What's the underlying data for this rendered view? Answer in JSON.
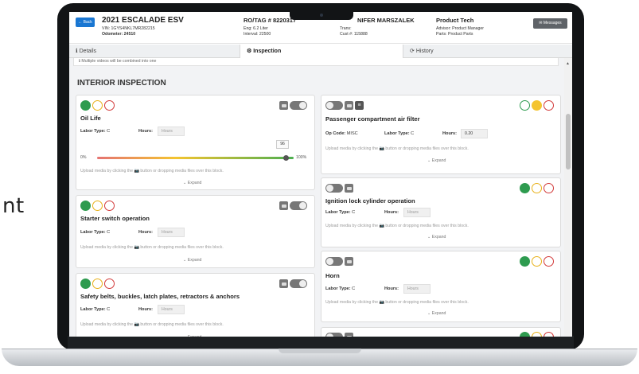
{
  "side_text": "nt",
  "header": {
    "back_label": "← Back",
    "vehicle": "2021 ESCALADE ESV",
    "vin": "VIN: 1GYS4NKL7MR282215",
    "odometer": "Odometer: 24510",
    "ro_tag": "RO/TAG # 8220317",
    "eng": "Eng: 6.2 Liter",
    "interval": "Interval: 22500",
    "customer": "NIFER MARSZALEK",
    "trans": "Trans:",
    "cust_no": "Cust #: 115888",
    "role": "Product Tech",
    "advisor": "Advisor: Product Manager",
    "parts": "Parts: Product Parts",
    "messages_label": "Messages"
  },
  "tabs": [
    {
      "icon": "ℹ",
      "label": "Details"
    },
    {
      "icon": "⚙",
      "label": "Inspection"
    },
    {
      "icon": "⟳",
      "label": "History"
    }
  ],
  "note": "Multiple videos will be combined into one",
  "section_title": "INTERIOR INSPECTION",
  "labels": {
    "labor_type": "Labor Type:",
    "hours": "Hours:",
    "op_code": "Op Code:",
    "hours_placeholder": "Hours",
    "upload": "Upload media by clicking the 📷 button or dropping media files over this block.",
    "expand": "⌄ Expand",
    "slider_min": "0%",
    "slider_max": "100%"
  },
  "cards": [
    {
      "title": "Oil Life",
      "labor_type": "C",
      "status": "green",
      "slider_value": "96",
      "slider_fraction": 0.96
    },
    {
      "title": "Starter switch operation",
      "labor_type": "C",
      "status": "green"
    },
    {
      "title": "Safety belts, buckles, latch plates, retractors & anchors",
      "labor_type": "C",
      "status": "green"
    },
    {
      "title": "Passenger compartment air filter",
      "op_code": "MISC",
      "labor_type": "C",
      "hours": "0.20",
      "status": "yellow"
    },
    {
      "title": "Ignition lock cylinder operation",
      "labor_type": "C",
      "status": "green"
    },
    {
      "title": "Horn",
      "labor_type": "C",
      "status": "green"
    }
  ],
  "colors": {
    "green": "#2e9b4f",
    "yellow": "#f4c430",
    "red": "#d23a3a",
    "accent": "#1976d2"
  }
}
